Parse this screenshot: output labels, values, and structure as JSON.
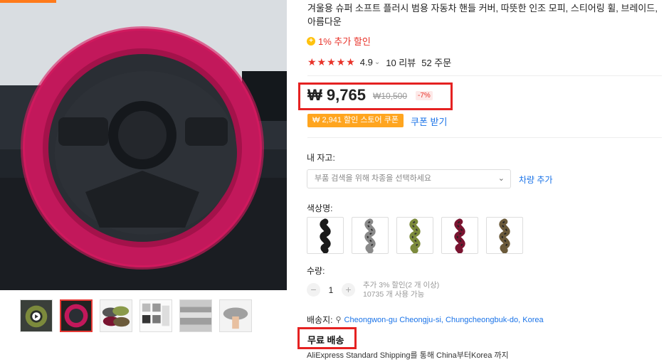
{
  "product": {
    "title": "겨울용 슈퍼 소프트 플러시 범용 자동차 핸들 커버, 따뜻한 인조 모피, 스티어링 휠, 브레이드, 아름다운",
    "extra_discount": "1% 추가 할인",
    "rating": {
      "value": "4.9",
      "stars": 5,
      "reviews": "10 리뷰",
      "orders": "52 주문"
    },
    "price": "₩ 9,765",
    "original_price": "₩10,500",
    "discount_pct": "-7%",
    "coupon": "₩ 2,941 할인 스토어 쿠폰",
    "coupon_link": "쿠폰 받기"
  },
  "vehicle": {
    "label": "내 자고:",
    "placeholder": "부품 검색을 위해 차종을 선택하세요",
    "add_link": "차량 추가"
  },
  "color": {
    "label": "색상명:",
    "options": [
      {
        "name": "black",
        "hex": "#1a1a1a"
      },
      {
        "name": "gray",
        "hex": "#8a8a8a"
      },
      {
        "name": "green",
        "hex": "#7c8a3c"
      },
      {
        "name": "wine",
        "hex": "#7a1430"
      },
      {
        "name": "brown",
        "hex": "#6b5a3a"
      }
    ]
  },
  "quantity": {
    "label": "수량:",
    "value": "1",
    "info_line1": "추가 3% 할인(2 개 이상)",
    "info_line2": "10735 개 사용 가능"
  },
  "shipping": {
    "label": "배송지:",
    "location": "Cheongwon-gu Cheongju-si, Chungcheongbuk-do, Korea",
    "free": "무료 배송",
    "method": "AliExpress Standard Shipping를 통해 China부터Korea 까지"
  },
  "colors": {
    "accent_red": "#e8332a",
    "link_blue": "#1a73e8",
    "coupon_orange": "#ffa51f",
    "highlight_box": "#e52222"
  }
}
